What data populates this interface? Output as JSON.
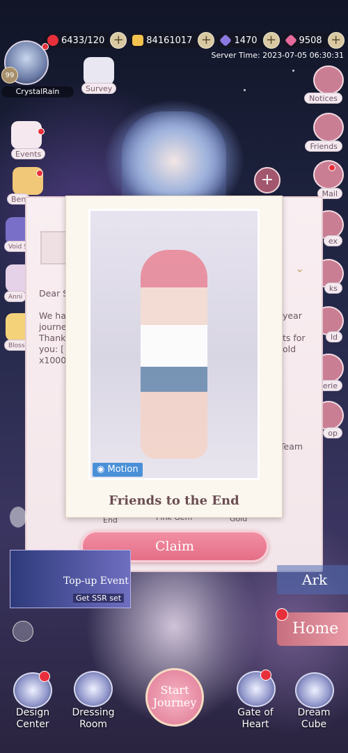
{
  "resources": [
    {
      "name": "heart-icon",
      "value": "6433/120",
      "color": "#e8303c"
    },
    {
      "name": "coin-icon",
      "value": "84161017",
      "color": "#f3c24e"
    },
    {
      "name": "diamond-icon",
      "value": "1470",
      "color": "#8a7ae0"
    },
    {
      "name": "pink-diamond-icon",
      "value": "9508",
      "color": "#e66b9c"
    }
  ],
  "server_time": "Server Time: 2023-07-05 06:30:31",
  "player": {
    "level": "99",
    "name": "CrystalRain"
  },
  "left_menu": [
    "Survey",
    "Events",
    "Ben",
    "Void S",
    "Anni",
    "Blossom"
  ],
  "right_menu": [
    "Notices",
    "Friends",
    "Mail",
    "ex",
    "ks",
    "ld",
    "erie",
    "op"
  ],
  "letter": {
    "greeting": "Dear S",
    "body_left": "We ha\njourne\nThank\nyou: [\nx1000",
    "body_right": "year\n\nts for\nold",
    "signature": "Team",
    "rewards": [
      "End",
      "Pink Gem",
      "Gold"
    ]
  },
  "card": {
    "motion": "Motion",
    "title": "Friends to the End"
  },
  "claim_label": "Claim",
  "topup": {
    "title": "Top-up Event",
    "sub": "Get SSR set"
  },
  "ark_label": "Ark",
  "home_label": "Home",
  "bottom_nav": [
    {
      "label": "Design\nCenter"
    },
    {
      "label": "Dressing\nRoom"
    },
    {
      "label": "Start\nJourney"
    },
    {
      "label": "Gate of\nHeart"
    },
    {
      "label": "Dream\nCube"
    }
  ]
}
